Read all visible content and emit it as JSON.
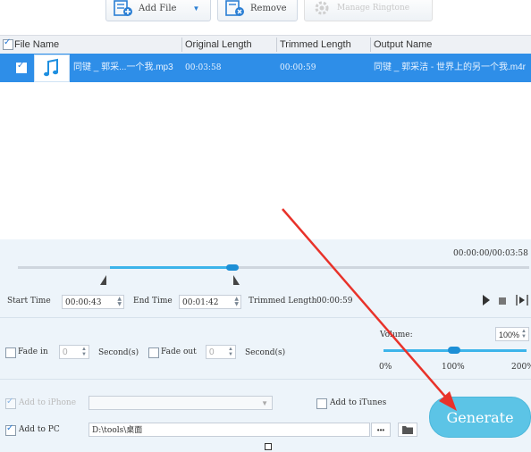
{
  "toolbar": {
    "add_file": "Add File",
    "remove": "Remove",
    "manage_ringtone": "Manage Ringtone"
  },
  "table": {
    "columns": [
      "File Name",
      "Original Length",
      "Trimmed Length",
      "Output Name"
    ],
    "rows": [
      {
        "file_name": "同键 _ 郭采...一个我.mp3",
        "original_length": "00:03:58",
        "trimmed_length": "00:00:59",
        "output_name": "同键 _ 郭采洁 - 世界上的另一个我.m4r"
      }
    ]
  },
  "timeline": {
    "time_readout": "00:00:00/00:03:58",
    "selection_start": 0.18,
    "selection_end": 0.42
  },
  "trim": {
    "start_label": "Start Time",
    "start_value": "00:00:43",
    "end_label": "End Time",
    "end_value": "00:01:42",
    "trimmed_label": "Trimmed Length",
    "trimmed_value": "00:00:59"
  },
  "fade": {
    "fade_in_label": "Fade in",
    "fade_in_value": "0",
    "fade_out_label": "Fade out",
    "fade_out_value": "0",
    "unit": "Second(s)"
  },
  "volume": {
    "label": "Volume:",
    "value": "100%",
    "ticks": [
      "0%",
      "100%",
      "200%"
    ]
  },
  "output": {
    "add_iphone_label": "Add to iPhone",
    "add_itunes_label": "Add to iTunes",
    "add_pc_label": "Add to PC",
    "path": "D:\\tools\\桌面",
    "browse_label": "•••",
    "generate_label": "Generate"
  },
  "colors": {
    "selected_row": "#2e8ee8",
    "panel_bg": "#edf4fa",
    "accent": "#3db4ea",
    "generate": "#5cc4e6",
    "annotation_arrow": "#e8322a"
  }
}
